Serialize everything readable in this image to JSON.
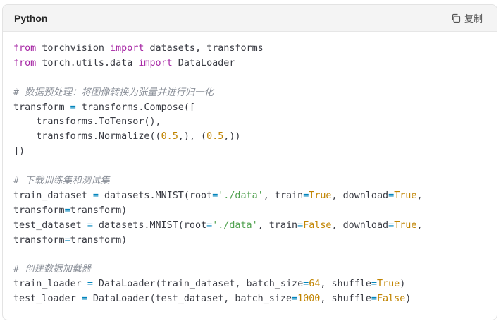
{
  "header": {
    "language": "Python",
    "copy_label": "复制"
  },
  "icons": {
    "copy": "copy-icon"
  },
  "colors": {
    "keyword": "#a626a4",
    "comment": "#8a8f98",
    "string": "#50a14f",
    "number": "#c18401",
    "operator": "#0184bc",
    "plain": "#383a42"
  },
  "code": {
    "lines": [
      [
        {
          "t": "kw",
          "v": "from"
        },
        {
          "t": "",
          "v": " torchvision "
        },
        {
          "t": "kw",
          "v": "import"
        },
        {
          "t": "",
          "v": " datasets, transforms"
        }
      ],
      [
        {
          "t": "kw",
          "v": "from"
        },
        {
          "t": "",
          "v": " torch.utils.data "
        },
        {
          "t": "kw",
          "v": "import"
        },
        {
          "t": "",
          "v": " DataLoader"
        }
      ],
      [],
      [
        {
          "t": "cm",
          "v": "# 数据预处理：将图像转换为张量并进行归一化"
        }
      ],
      [
        {
          "t": "",
          "v": "transform "
        },
        {
          "t": "op",
          "v": "="
        },
        {
          "t": "",
          "v": " transforms.Compose(["
        }
      ],
      [
        {
          "t": "",
          "v": "    transforms.ToTensor(),"
        }
      ],
      [
        {
          "t": "",
          "v": "    transforms.Normalize(("
        },
        {
          "t": "num",
          "v": "0.5"
        },
        {
          "t": "",
          "v": ",), ("
        },
        {
          "t": "num",
          "v": "0.5"
        },
        {
          "t": "",
          "v": ",))"
        }
      ],
      [
        {
          "t": "",
          "v": "])"
        }
      ],
      [],
      [
        {
          "t": "cm",
          "v": "# 下载训练集和测试集"
        }
      ],
      [
        {
          "t": "",
          "v": "train_dataset "
        },
        {
          "t": "op",
          "v": "="
        },
        {
          "t": "",
          "v": " datasets.MNIST(root"
        },
        {
          "t": "op",
          "v": "="
        },
        {
          "t": "str",
          "v": "'./data'"
        },
        {
          "t": "",
          "v": ", train"
        },
        {
          "t": "op",
          "v": "="
        },
        {
          "t": "const",
          "v": "True"
        },
        {
          "t": "",
          "v": ", download"
        },
        {
          "t": "op",
          "v": "="
        },
        {
          "t": "const",
          "v": "True"
        },
        {
          "t": "",
          "v": ","
        }
      ],
      [
        {
          "t": "",
          "v": "transform"
        },
        {
          "t": "op",
          "v": "="
        },
        {
          "t": "",
          "v": "transform)"
        }
      ],
      [
        {
          "t": "",
          "v": "test_dataset "
        },
        {
          "t": "op",
          "v": "="
        },
        {
          "t": "",
          "v": " datasets.MNIST(root"
        },
        {
          "t": "op",
          "v": "="
        },
        {
          "t": "str",
          "v": "'./data'"
        },
        {
          "t": "",
          "v": ", train"
        },
        {
          "t": "op",
          "v": "="
        },
        {
          "t": "const",
          "v": "False"
        },
        {
          "t": "",
          "v": ", download"
        },
        {
          "t": "op",
          "v": "="
        },
        {
          "t": "const",
          "v": "True"
        },
        {
          "t": "",
          "v": ","
        }
      ],
      [
        {
          "t": "",
          "v": "transform"
        },
        {
          "t": "op",
          "v": "="
        },
        {
          "t": "",
          "v": "transform)"
        }
      ],
      [],
      [
        {
          "t": "cm",
          "v": "# 创建数据加载器"
        }
      ],
      [
        {
          "t": "",
          "v": "train_loader "
        },
        {
          "t": "op",
          "v": "="
        },
        {
          "t": "",
          "v": " DataLoader(train_dataset, batch_size"
        },
        {
          "t": "op",
          "v": "="
        },
        {
          "t": "num",
          "v": "64"
        },
        {
          "t": "",
          "v": ", shuffle"
        },
        {
          "t": "op",
          "v": "="
        },
        {
          "t": "const",
          "v": "True"
        },
        {
          "t": "",
          "v": ")"
        }
      ],
      [
        {
          "t": "",
          "v": "test_loader "
        },
        {
          "t": "op",
          "v": "="
        },
        {
          "t": "",
          "v": " DataLoader(test_dataset, batch_size"
        },
        {
          "t": "op",
          "v": "="
        },
        {
          "t": "num",
          "v": "1000"
        },
        {
          "t": "",
          "v": ", shuffle"
        },
        {
          "t": "op",
          "v": "="
        },
        {
          "t": "const",
          "v": "False"
        },
        {
          "t": "",
          "v": ")"
        }
      ]
    ]
  }
}
